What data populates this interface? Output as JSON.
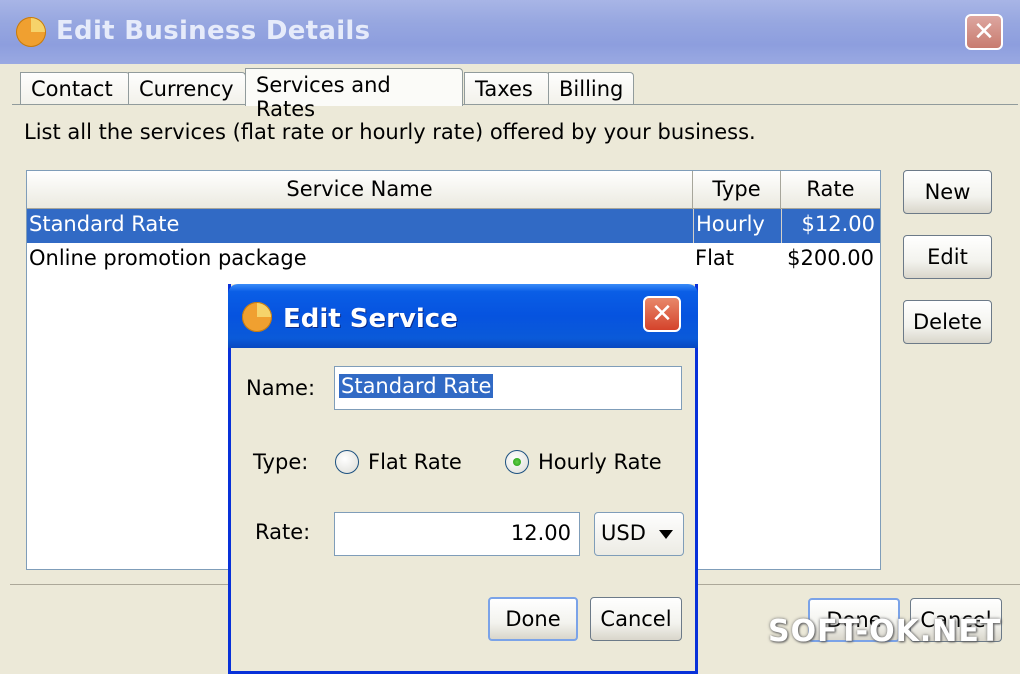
{
  "window": {
    "title": "Edit Business Details"
  },
  "tabs": [
    {
      "label": "Contact"
    },
    {
      "label": "Currency"
    },
    {
      "label": "Services and Rates",
      "active": true
    },
    {
      "label": "Taxes"
    },
    {
      "label": "Billing"
    }
  ],
  "panel": {
    "description": "List all the services (flat rate or hourly rate) offered by your business."
  },
  "table": {
    "columns": [
      "Service Name",
      "Type",
      "Rate"
    ],
    "rows": [
      {
        "name": "Standard Rate",
        "type": "Hourly",
        "rate": "$12.00",
        "selected": true
      },
      {
        "name": "Online promotion package",
        "type": "Flat",
        "rate": "$200.00",
        "selected": false
      }
    ]
  },
  "side_buttons": {
    "new": "New",
    "edit": "Edit",
    "delete": "Delete"
  },
  "bottom_buttons": {
    "done": "Done",
    "cancel": "Cancel"
  },
  "dialog": {
    "title": "Edit Service",
    "name_label": "Name:",
    "name_value": "Standard Rate",
    "type_label": "Type:",
    "type_options": [
      "Flat Rate",
      "Hourly Rate"
    ],
    "type_selected": "Hourly Rate",
    "rate_label": "Rate:",
    "rate_value": "12.00",
    "currency": "USD",
    "done": "Done",
    "cancel": "Cancel"
  },
  "watermark": "SOFT-OK.NET",
  "colors": {
    "selection": "#316ac5",
    "dialog_title": "#0653df",
    "inactive_title": "#97a7e0"
  }
}
